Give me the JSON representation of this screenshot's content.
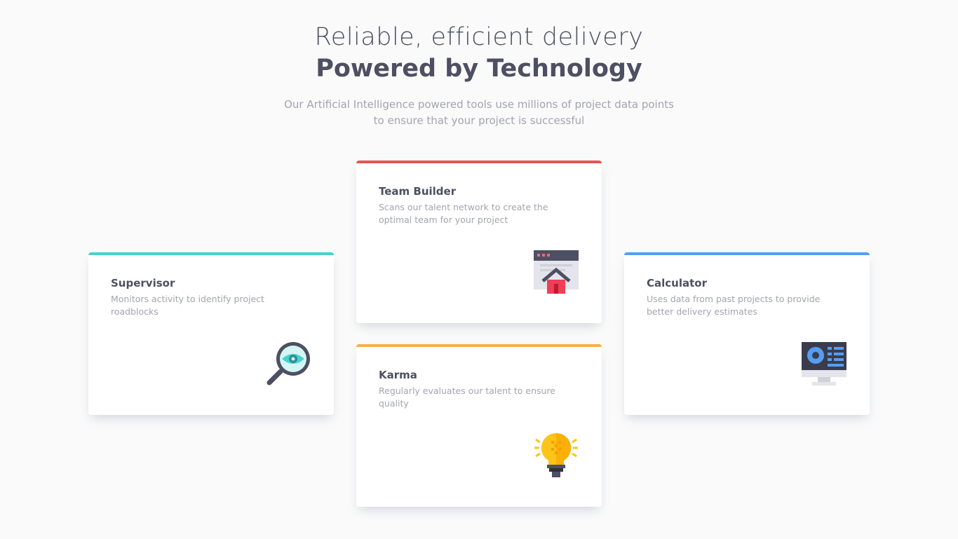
{
  "header": {
    "line1": "Reliable, efficient delivery",
    "line2": "Powered by Technology",
    "intro": "Our Artificial Intelligence powered tools use millions of project data points to ensure that your project is successful"
  },
  "cards": [
    {
      "title": "Supervisor",
      "text": "Monitors activity to identify project roadblocks",
      "accent": "#44d3d2",
      "icon": "magnifier-eye-icon"
    },
    {
      "title": "Team Builder",
      "text": "Scans our talent network to create the optimal team for your project",
      "accent": "#ea5454",
      "icon": "browser-house-icon"
    },
    {
      "title": "Karma",
      "text": "Regularly evaluates our talent to ensure quality",
      "accent": "#fcae4a",
      "icon": "lightbulb-icon"
    },
    {
      "title": "Calculator",
      "text": "Uses data from past projects to provide better delivery estimates",
      "accent": "#549ef2",
      "icon": "monitor-chart-icon"
    }
  ]
}
